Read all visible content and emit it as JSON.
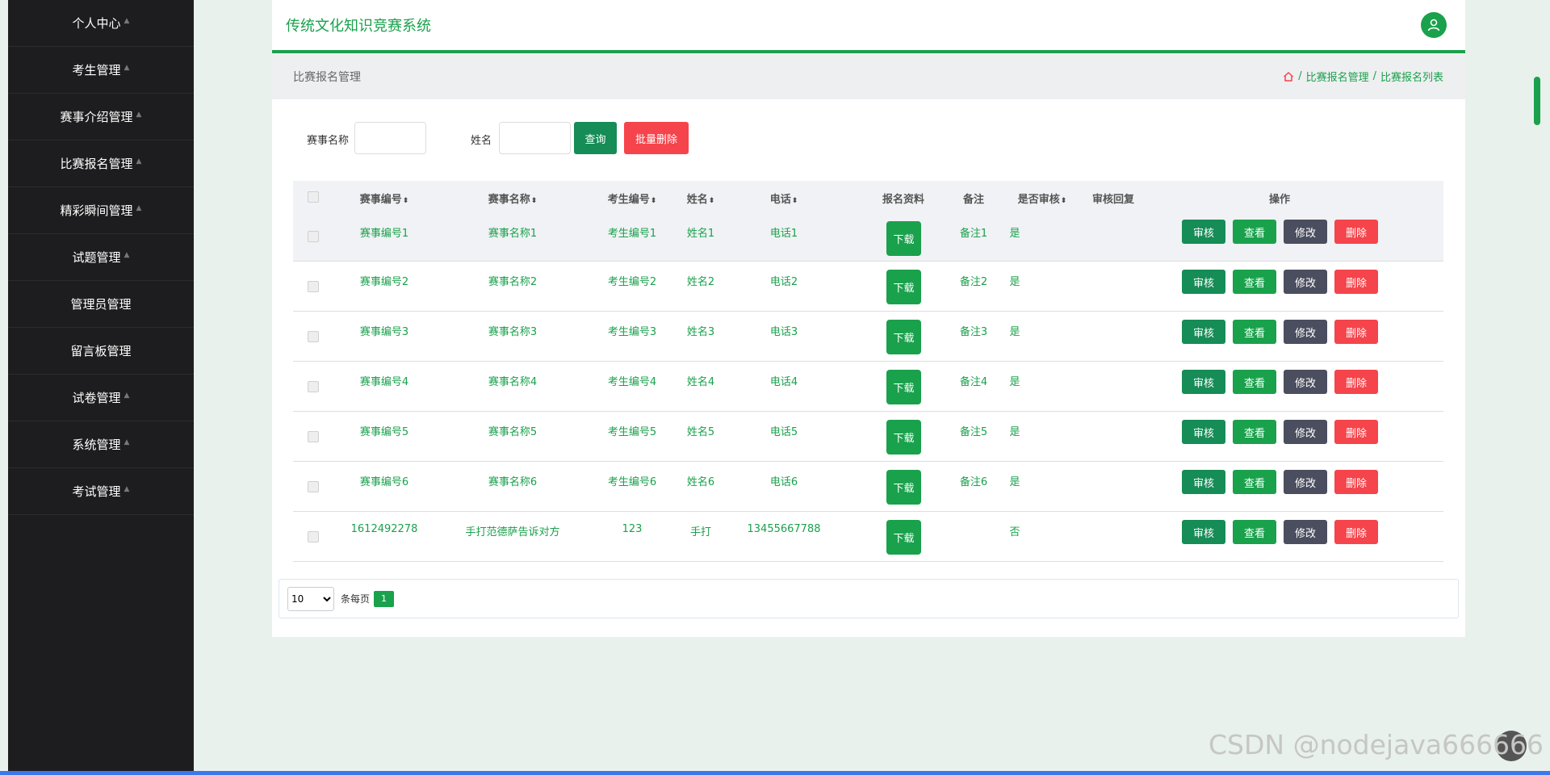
{
  "sidebar": {
    "items": [
      {
        "label": "个人中心"
      },
      {
        "label": "考生管理"
      },
      {
        "label": "赛事介绍管理"
      },
      {
        "label": "比赛报名管理"
      },
      {
        "label": "精彩瞬间管理"
      },
      {
        "label": "试题管理"
      },
      {
        "label": "管理员管理"
      },
      {
        "label": "留言板管理"
      },
      {
        "label": "试卷管理"
      },
      {
        "label": "系统管理"
      },
      {
        "label": "考试管理"
      }
    ]
  },
  "header": {
    "title": "传统文化知识竞赛系统"
  },
  "page": {
    "section_title": "比赛报名管理",
    "breadcrumb": [
      "比赛报名管理",
      "比赛报名列表"
    ]
  },
  "search": {
    "name_label": "赛事名称",
    "person_label": "姓名",
    "query_label": "查询",
    "batch_delete_label": "批量删除"
  },
  "table": {
    "columns": [
      "赛事编号",
      "赛事名称",
      "考生编号",
      "姓名",
      "电话",
      "报名资料",
      "备注",
      "是否审核",
      "审核回复",
      "操作"
    ],
    "download_label": "下载",
    "actions": {
      "audit": "审核",
      "view": "查看",
      "edit": "修改",
      "delete": "删除"
    },
    "rows": [
      {
        "id": "赛事编号1",
        "name": "赛事名称1",
        "student": "考生编号1",
        "person": "姓名1",
        "phone": "电话1",
        "remark": "备注1",
        "audited": "是",
        "reply": ""
      },
      {
        "id": "赛事编号2",
        "name": "赛事名称2",
        "student": "考生编号2",
        "person": "姓名2",
        "phone": "电话2",
        "remark": "备注2",
        "audited": "是",
        "reply": ""
      },
      {
        "id": "赛事编号3",
        "name": "赛事名称3",
        "student": "考生编号3",
        "person": "姓名3",
        "phone": "电话3",
        "remark": "备注3",
        "audited": "是",
        "reply": ""
      },
      {
        "id": "赛事编号4",
        "name": "赛事名称4",
        "student": "考生编号4",
        "person": "姓名4",
        "phone": "电话4",
        "remark": "备注4",
        "audited": "是",
        "reply": ""
      },
      {
        "id": "赛事编号5",
        "name": "赛事名称5",
        "student": "考生编号5",
        "person": "姓名5",
        "phone": "电话5",
        "remark": "备注5",
        "audited": "是",
        "reply": ""
      },
      {
        "id": "赛事编号6",
        "name": "赛事名称6",
        "student": "考生编号6",
        "person": "姓名6",
        "phone": "电话6",
        "remark": "备注6",
        "audited": "是",
        "reply": ""
      },
      {
        "id": "1612492278",
        "name": "手打范德萨告诉对方",
        "student": "123",
        "person": "手打",
        "phone": "13455667788",
        "remark": "",
        "audited": "否",
        "reply": ""
      }
    ]
  },
  "pagination": {
    "page_size": "10",
    "page_size_options": [
      "10"
    ],
    "per_page_label": "条每页",
    "current_page": "1"
  },
  "watermark": "CSDN @nodejava666666",
  "colors": {
    "accent": "#1aa14c",
    "audit": "#168c56",
    "edit": "#4b4e5e",
    "danger": "#f5444b",
    "sidebar": "#1d1d1f"
  }
}
